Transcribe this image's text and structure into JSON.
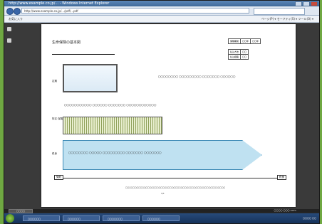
{
  "browser": {
    "title": "http://www.example.co.jp/... - Windows Internet Explorer",
    "address": "http://www.example.co.jp/.../pdf/...pdf",
    "command_left": "お気に入り",
    "command_right": "ページ(P) ▾  セーフティ(S) ▾  ツール(O) ▾"
  },
  "doc": {
    "title": "生命保険の基本図",
    "info_table": [
      [
        "保険期間",
        "〇〇年",
        "〇〇年"
      ],
      [
        "保険料払込",
        "〇〇年",
        "〇〇年"
      ]
    ],
    "info_table2": [
      [
        "払込方法",
        "〇〇"
      ],
      [
        "払込経路",
        "〇〇"
      ]
    ],
    "labels": {
      "row1": "定期",
      "row2": "特定\n保険",
      "row3": "終身"
    },
    "blue_text": "〇〇〇〇〇〇〇〇  〇〇〇〇〇〇〇〇〇\n〇〇〇〇〇〇〇  〇〇〇〇〇〇",
    "green_text": "〇〇〇〇〇〇〇〇〇〇〇  〇〇〇〇〇〇  〇〇〇〇〇〇〇\n〇〇〇〇〇〇〇〇〇〇〇〇",
    "arrow_text": "〇〇〇〇〇〇〇〇  〇〇〇〇〇  〇〇〇〇〇〇〇〇〇\n〇〇〇〇〇〇〇  〇〇〇〇〇〇〇",
    "axis_start": "契約",
    "axis_end": "終身",
    "footnote": "〇〇〇〇〇〇〇〇〇〇〇〇〇〇〇〇〇〇〇〇〇〇〇〇〇〇〇〇〇〇〇〇〇〇〇〇〇〇〇〇〇〇〇〇〇〇〇〇〇〇〇〇〇〇",
    "page_no": "1/1"
  },
  "viewer": {
    "left_chip": "〇〇〇〇",
    "right_text": "〇〇〇〇  〇〇〇  100%"
  },
  "taskbar": {
    "buttons": [
      "〇〇〇〇〇〇",
      "〇〇〇〇〇〇",
      "〇〇〇〇〇〇〇",
      "〇〇〇〇〇〇"
    ],
    "tray": "〇〇〇〇  〇〇"
  }
}
